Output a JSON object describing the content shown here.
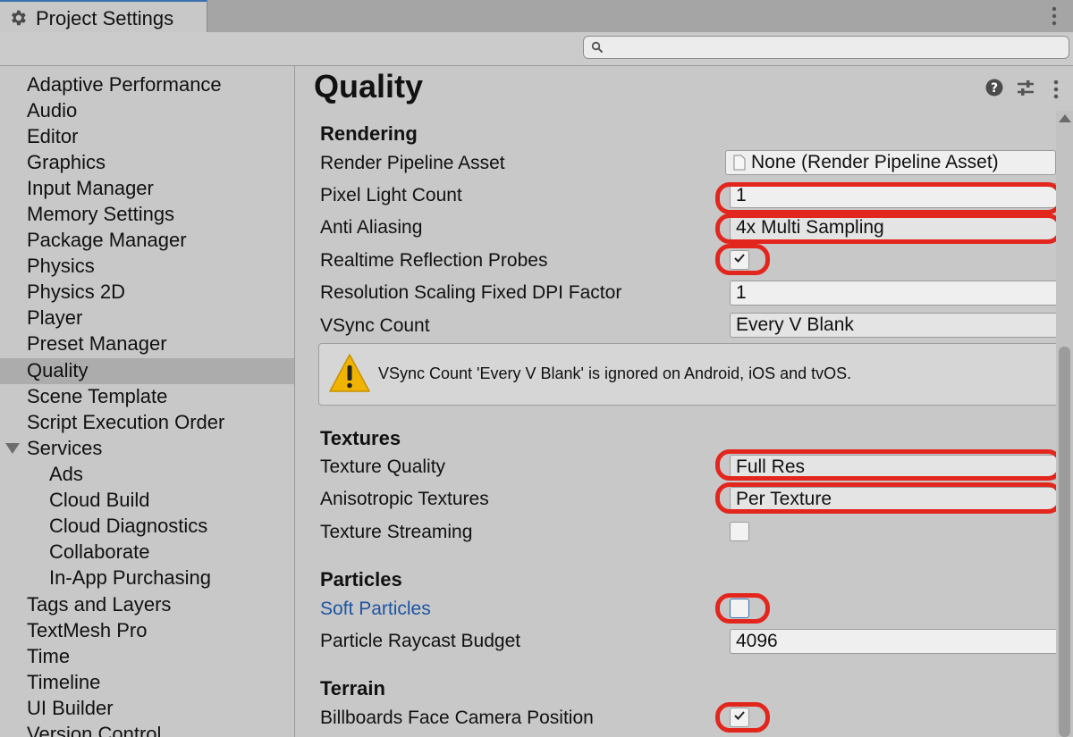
{
  "window": {
    "tab_title": "Project Settings",
    "search_placeholder": ""
  },
  "sidebar": {
    "selected": "Quality",
    "items": [
      {
        "label": "Adaptive Performance"
      },
      {
        "label": "Audio"
      },
      {
        "label": "Editor"
      },
      {
        "label": "Graphics"
      },
      {
        "label": "Input Manager"
      },
      {
        "label": "Memory Settings"
      },
      {
        "label": "Package Manager"
      },
      {
        "label": "Physics"
      },
      {
        "label": "Physics 2D"
      },
      {
        "label": "Player"
      },
      {
        "label": "Preset Manager"
      },
      {
        "label": "Quality"
      },
      {
        "label": "Scene Template"
      },
      {
        "label": "Script Execution Order"
      },
      {
        "label": "Services"
      },
      {
        "label": "Ads"
      },
      {
        "label": "Cloud Build"
      },
      {
        "label": "Cloud Diagnostics"
      },
      {
        "label": "Collaborate"
      },
      {
        "label": "In-App Purchasing"
      },
      {
        "label": "Tags and Layers"
      },
      {
        "label": "TextMesh Pro"
      },
      {
        "label": "Time"
      },
      {
        "label": "Timeline"
      },
      {
        "label": "UI Builder"
      },
      {
        "label": "Version Control"
      }
    ]
  },
  "main": {
    "title": "Quality",
    "rendering": {
      "heading": "Rendering",
      "render_pipeline_asset_label": "Render Pipeline Asset",
      "render_pipeline_asset_value": "None (Render Pipeline Asset)",
      "pixel_light_count_label": "Pixel Light Count",
      "pixel_light_count_value": "1",
      "anti_aliasing_label": "Anti Aliasing",
      "anti_aliasing_value": "4x Multi Sampling",
      "realtime_reflection_probes_label": "Realtime Reflection Probes",
      "realtime_reflection_probes_checked": true,
      "resolution_scaling_label": "Resolution Scaling Fixed DPI Factor",
      "resolution_scaling_value": "1",
      "vsync_count_label": "VSync Count",
      "vsync_count_value": "Every V Blank",
      "vsync_warning": "VSync Count 'Every V Blank' is ignored on Android, iOS and tvOS."
    },
    "textures": {
      "heading": "Textures",
      "texture_quality_label": "Texture Quality",
      "texture_quality_value": "Full Res",
      "anisotropic_label": "Anisotropic Textures",
      "anisotropic_value": "Per Texture",
      "streaming_label": "Texture Streaming",
      "streaming_checked": false
    },
    "particles": {
      "heading": "Particles",
      "soft_particles_label": "Soft Particles",
      "soft_particles_checked": false,
      "raycast_budget_label": "Particle Raycast Budget",
      "raycast_budget_value": "4096"
    },
    "terrain": {
      "heading": "Terrain",
      "billboards_label": "Billboards Face Camera Position",
      "billboards_checked": true
    }
  },
  "colors": {
    "highlight": "#e3261d",
    "selection": "#acacac",
    "link": "#1d55a3",
    "warning": "#f0b400"
  }
}
